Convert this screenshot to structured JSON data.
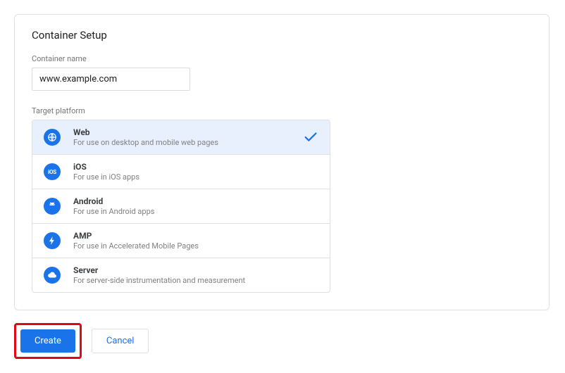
{
  "title": "Container Setup",
  "fields": {
    "containerName": {
      "label": "Container name",
      "value": "www.example.com"
    },
    "targetPlatform": {
      "label": "Target platform"
    }
  },
  "platforms": [
    {
      "id": "web",
      "name": "Web",
      "desc": "For use on desktop and mobile web pages",
      "selected": true
    },
    {
      "id": "ios",
      "name": "iOS",
      "desc": "For use in iOS apps",
      "selected": false
    },
    {
      "id": "android",
      "name": "Android",
      "desc": "For use in Android apps",
      "selected": false
    },
    {
      "id": "amp",
      "name": "AMP",
      "desc": "For use in Accelerated Mobile Pages",
      "selected": false
    },
    {
      "id": "server",
      "name": "Server",
      "desc": "For server-side instrumentation and measurement",
      "selected": false
    }
  ],
  "buttons": {
    "create": "Create",
    "cancel": "Cancel"
  }
}
